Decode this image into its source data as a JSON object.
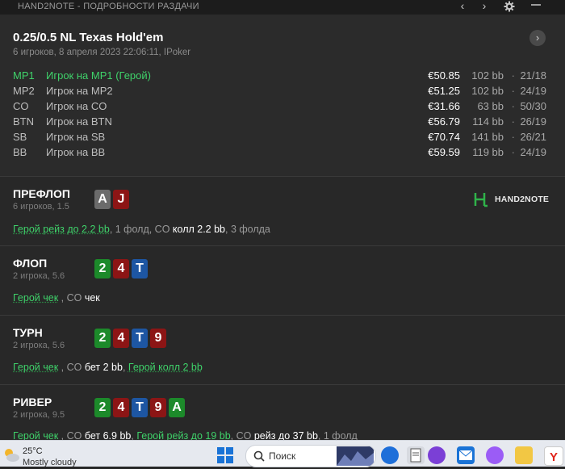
{
  "titlebar": {
    "title": "HAND2NOTE - ПОДРОБНОСТИ РАЗДАЧИ"
  },
  "game": {
    "title": "0.25/0.5 NL Texas Hold'em",
    "subtitle": "6 игроков, 8 апреля 2023 22:06:11, IPoker"
  },
  "players": [
    {
      "pos": "MP1",
      "name": "Игрок на MP1 (Герой)",
      "stack": "€50.85",
      "bb": "102 bb",
      "dot": "·",
      "stat": "21/18",
      "hero": true
    },
    {
      "pos": "MP2",
      "name": "Игрок на MP2",
      "stack": "€51.25",
      "bb": "102 bb",
      "dot": "·",
      "stat": "24/19",
      "hero": false
    },
    {
      "pos": "CO",
      "name": "Игрок на CO",
      "stack": "€31.66",
      "bb": "63 bb",
      "dot": "·",
      "stat": "50/30",
      "hero": false
    },
    {
      "pos": "BTN",
      "name": "Игрок на BTN",
      "stack": "€56.79",
      "bb": "114 bb",
      "dot": "·",
      "stat": "26/19",
      "hero": false
    },
    {
      "pos": "SB",
      "name": "Игрок на SB",
      "stack": "€70.74",
      "bb": "141 bb",
      "dot": "·",
      "stat": "26/21",
      "hero": false
    },
    {
      "pos": "BB",
      "name": "Игрок на BB",
      "stack": "€59.59",
      "bb": "119 bb",
      "dot": "·",
      "stat": "24/19",
      "hero": false
    }
  ],
  "logo": {
    "text": "HAND2NOTE"
  },
  "streets": {
    "preflop": {
      "name": "ПРЕФЛОП",
      "sub": "6 игроков, 1.5",
      "cards": [
        {
          "rank": "A",
          "suit": "grey"
        },
        {
          "rank": "J",
          "suit": "red"
        }
      ],
      "actions": [
        {
          "t": "Герой рейз до 2.2 bb",
          "s": "hero"
        },
        {
          "t": ", 1 фолд, CO ",
          "s": "n"
        },
        {
          "t": "колл 2.2 bb",
          "s": "w"
        },
        {
          "t": ", 3 фолда",
          "s": "n"
        }
      ]
    },
    "flop": {
      "name": "ФЛОП",
      "sub": "2 игрока, 5.6",
      "cards": [
        {
          "rank": "2",
          "suit": "green"
        },
        {
          "rank": "4",
          "suit": "red"
        },
        {
          "rank": "T",
          "suit": "blue"
        }
      ],
      "actions": [
        {
          "t": "Герой чек",
          "s": "hero"
        },
        {
          "t": " , CO ",
          "s": "n"
        },
        {
          "t": "чек",
          "s": "w"
        }
      ]
    },
    "turn": {
      "name": "ТУРН",
      "sub": "2 игрока, 5.6",
      "cards": [
        {
          "rank": "2",
          "suit": "green"
        },
        {
          "rank": "4",
          "suit": "red"
        },
        {
          "rank": "T",
          "suit": "blue"
        },
        {
          "rank": "9",
          "suit": "red"
        }
      ],
      "actions": [
        {
          "t": "Герой чек",
          "s": "hero"
        },
        {
          "t": " , CO ",
          "s": "n"
        },
        {
          "t": "бет 2 bb",
          "s": "w"
        },
        {
          "t": ", ",
          "s": "n"
        },
        {
          "t": "Герой колл 2 bb",
          "s": "hero"
        }
      ]
    },
    "river": {
      "name": "РИВЕР",
      "sub": "2 игрока, 9.5",
      "cards": [
        {
          "rank": "2",
          "suit": "green"
        },
        {
          "rank": "4",
          "suit": "red"
        },
        {
          "rank": "T",
          "suit": "blue"
        },
        {
          "rank": "9",
          "suit": "red"
        },
        {
          "rank": "A",
          "suit": "green"
        }
      ],
      "actions": [
        {
          "t": "Герой чек",
          "s": "hero"
        },
        {
          "t": " , CO ",
          "s": "n"
        },
        {
          "t": "бет 6.9 bb",
          "s": "w"
        },
        {
          "t": ", ",
          "s": "n"
        },
        {
          "t": "Герой рейз до 19 bb",
          "s": "hero"
        },
        {
          "t": ", CO ",
          "s": "n"
        },
        {
          "t": "рейз до 37 bb",
          "s": "w"
        },
        {
          "t": ", 1 фолд",
          "s": "n"
        }
      ]
    }
  },
  "taskbar": {
    "temperature": "25°C",
    "condition": "Mostly cloudy",
    "search_label": "Поиск"
  }
}
